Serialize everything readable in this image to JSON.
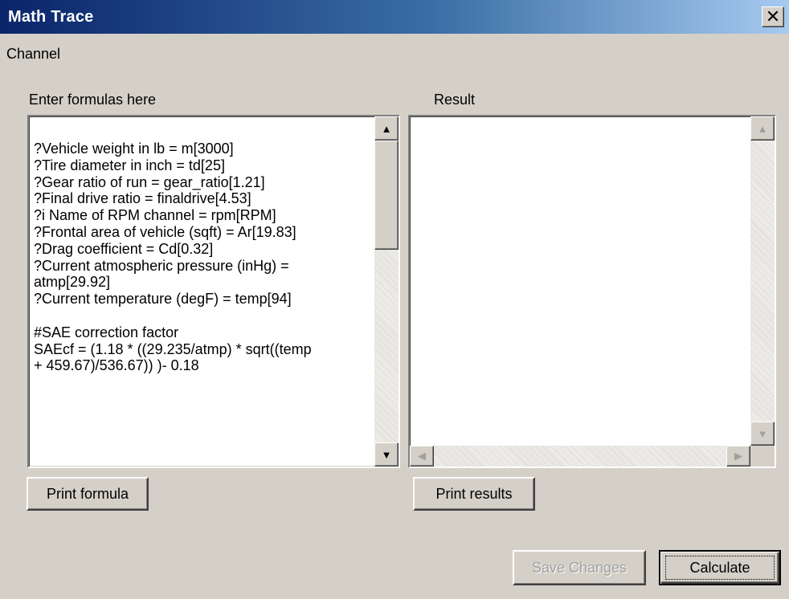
{
  "window": {
    "title": "Math Trace",
    "close_glyph": "✕"
  },
  "menu": {
    "items": [
      "Channel"
    ]
  },
  "formula_panel": {
    "label": "Enter formulas here",
    "text": "?Vehicle weight in lb = m[3000]\n?Tire diameter in inch = td[25]\n?Gear ratio of run = gear_ratio[1.21]\n?Final drive ratio = finaldrive[4.53]\n?i Name of RPM channel = rpm[RPM]\n?Frontal area of vehicle (sqft) = Ar[19.83]\n?Drag coefficient = Cd[0.32]\n?Current atmospheric pressure (inHg) =\natmp[29.92]\n?Current temperature (degF) = temp[94]\n\n#SAE correction factor\nSAEcf = (1.18 * ((29.235/atmp) * sqrt((temp\n+ 459.67)/536.67)) )- 0.18",
    "print_button": "Print formula"
  },
  "result_panel": {
    "label": "Result",
    "text": "",
    "print_button": "Print results"
  },
  "footer": {
    "save_button": "Save Changes",
    "save_enabled": false,
    "calculate_button": "Calculate"
  },
  "icons": {
    "scroll_up": "arrow-up-icon",
    "scroll_down": "arrow-down-icon",
    "scroll_left": "arrow-left-icon",
    "scroll_right": "arrow-right-icon"
  },
  "colors": {
    "titlebar_start": "#0a246a",
    "titlebar_end": "#a6caf0",
    "face": "#d4d0c8",
    "disabled_text": "#a0a0a0"
  }
}
